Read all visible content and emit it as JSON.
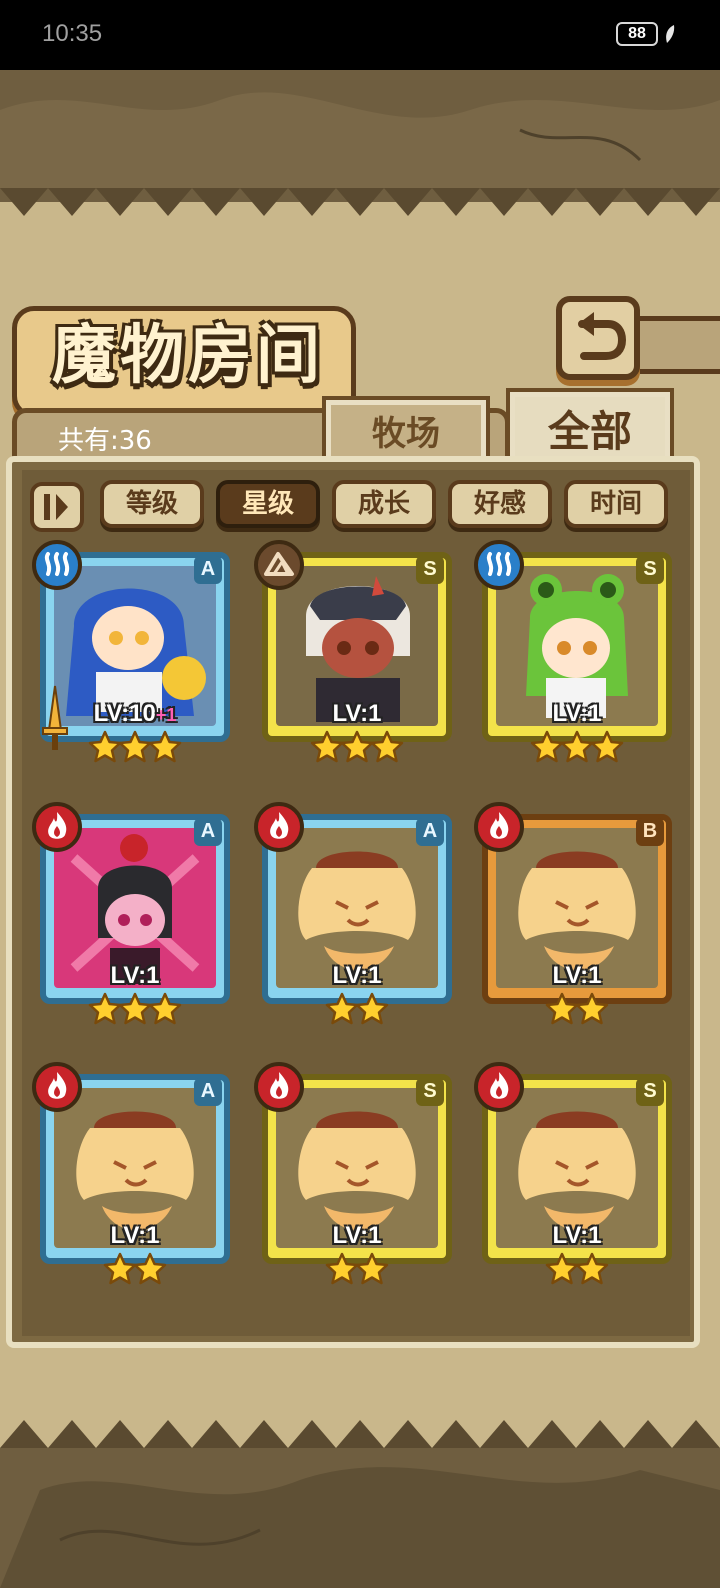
{
  "status_bar": {
    "time": "10:35",
    "battery": "88"
  },
  "title": "魔物房间",
  "count_label": "共有:36",
  "tabs": [
    {
      "label": "牧场",
      "selected": false
    },
    {
      "label": "全部",
      "selected": true
    }
  ],
  "sort_buttons": [
    {
      "label": "等级",
      "active": false
    },
    {
      "label": "星级",
      "active": true
    },
    {
      "label": "成长",
      "active": false
    },
    {
      "label": "好感",
      "active": false
    },
    {
      "label": "时间",
      "active": false
    }
  ],
  "monsters": [
    {
      "element": "water-icon",
      "grade": "A",
      "level": "LV:10",
      "bonus": "+1",
      "stars": 3,
      "frame": "blue",
      "portrait": "blue-hair-catgirl"
    },
    {
      "element": "earth-icon",
      "grade": "S",
      "level": "LV:1",
      "bonus": "",
      "stars": 3,
      "frame": "gold",
      "portrait": "horned-dark-girl"
    },
    {
      "element": "water-icon",
      "grade": "S",
      "level": "LV:1",
      "bonus": "",
      "stars": 3,
      "frame": "gold",
      "portrait": "frog-hood-girl"
    },
    {
      "element": "fire-icon",
      "grade": "A",
      "level": "LV:1",
      "bonus": "",
      "stars": 3,
      "frame": "blue",
      "portrait": "flower-girl"
    },
    {
      "element": "fire-icon",
      "grade": "A",
      "level": "LV:1",
      "bonus": "",
      "stars": 2,
      "frame": "blue",
      "portrait": "pudding-slime"
    },
    {
      "element": "fire-icon",
      "grade": "B",
      "level": "LV:1",
      "bonus": "",
      "stars": 2,
      "frame": "bronze",
      "portrait": "pudding-slime"
    },
    {
      "element": "fire-icon",
      "grade": "A",
      "level": "LV:1",
      "bonus": "",
      "stars": 2,
      "frame": "blue",
      "portrait": "pudding-slime"
    },
    {
      "element": "fire-icon",
      "grade": "S",
      "level": "LV:1",
      "bonus": "",
      "stars": 2,
      "frame": "gold",
      "portrait": "pudding-slime"
    },
    {
      "element": "fire-icon",
      "grade": "S",
      "level": "LV:1",
      "bonus": "",
      "stars": 2,
      "frame": "gold",
      "portrait": "pudding-slime"
    }
  ],
  "colors": {
    "water": "#2a7fc9",
    "fire": "#c8242a",
    "earth": "#6b4a2d",
    "star": "#ffcf2e"
  }
}
